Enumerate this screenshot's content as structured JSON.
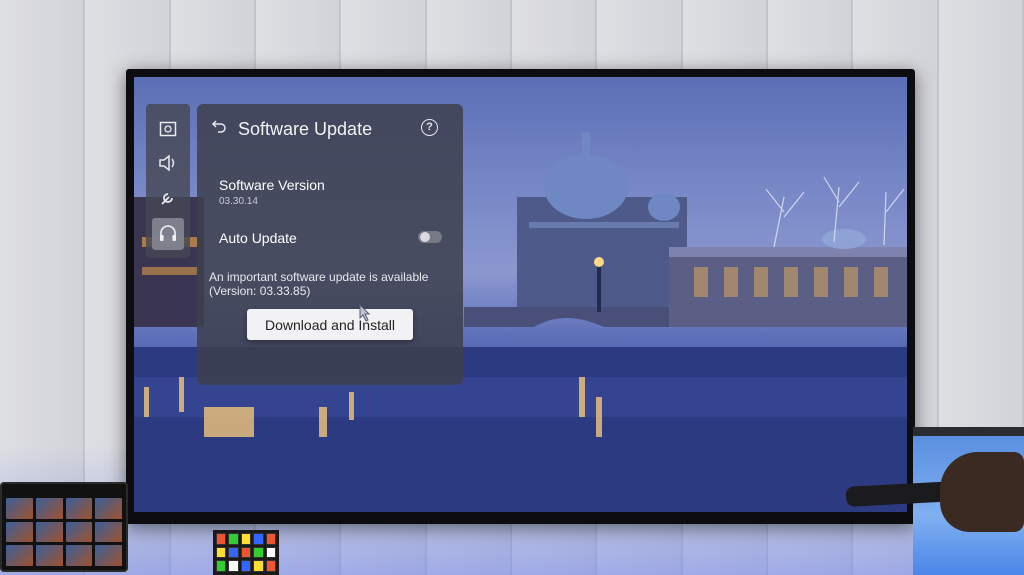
{
  "sidebar": {
    "items": [
      {
        "icon": "picture-icon"
      },
      {
        "icon": "sound-icon"
      },
      {
        "icon": "wrench-icon"
      },
      {
        "icon": "headset-support-icon",
        "active": true
      }
    ]
  },
  "panel": {
    "back_icon": "back-arrow-icon",
    "title": "Software Update",
    "help_icon": "help-icon",
    "help_glyph": "?",
    "software_version_label": "Software Version",
    "software_version_value": "03.30.14",
    "auto_update_label": "Auto Update",
    "auto_update_enabled": false,
    "notice_line1": "An important software update is available",
    "notice_line2": "(Version: 03.33.85)",
    "download_button_label": "Download and Install"
  },
  "colors": {
    "panel_bg": "#3e404e",
    "button_bg": "#f2f2f4",
    "screen_sky": "#6b7dc2"
  }
}
